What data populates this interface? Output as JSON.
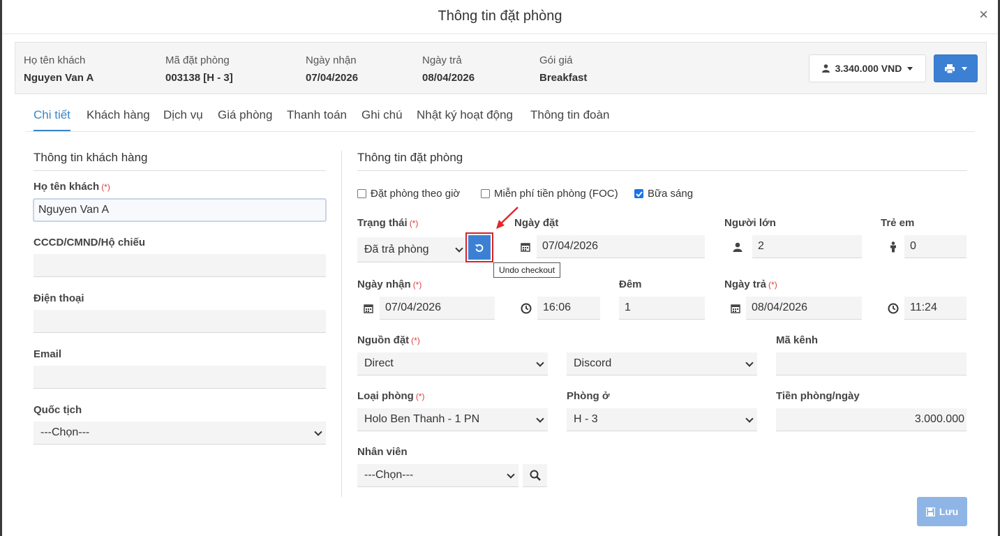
{
  "modal": {
    "title": "Thông tin đặt phòng",
    "close": "×"
  },
  "summary": {
    "guest_label": "Họ tên khách",
    "guest_value": "Nguyen Van A",
    "code_label": "Mã đặt phòng",
    "code_value": "003138 [H - 3]",
    "checkin_label": "Ngày nhận",
    "checkin_value": "07/04/2026",
    "checkout_label": "Ngày trả",
    "checkout_value": "08/04/2026",
    "package_label": "Gói giá",
    "package_value": "Breakfast",
    "total": "3.340.000 VND"
  },
  "tabs": [
    "Chi tiết",
    "Khách hàng",
    "Dịch vụ",
    "Giá phòng",
    "Thanh toán",
    "Ghi chú",
    "Nhật ký hoạt động",
    "Thông tin đoàn"
  ],
  "left": {
    "title": "Thông tin khách hàng",
    "name_label": "Họ tên khách",
    "name_value": "Nguyen Van A",
    "id_label": "CCCD/CMND/Hộ chiếu",
    "id_value": "",
    "phone_label": "Điện thoại",
    "phone_value": "",
    "email_label": "Email",
    "email_value": "",
    "nationality_label": "Quốc tịch",
    "nationality_value": "---Chọn---"
  },
  "right": {
    "title": "Thông tin đặt phòng",
    "check_hourly": "Đặt phòng theo giờ",
    "check_foc": "Miễn phí tiền phòng (FOC)",
    "check_breakfast": "Bữa sáng",
    "status_label": "Trạng thái",
    "status_value": "Đã trả phòng",
    "booking_date_label": "Ngày đặt",
    "booking_date_value": "07/04/2026",
    "adults_label": "Người lớn",
    "adults_value": "2",
    "children_label": "Trẻ em",
    "children_value": "0",
    "checkin_label": "Ngày nhận",
    "checkin_date": "07/04/2026",
    "checkin_time": "16:06",
    "nights_label": "Đêm",
    "nights_value": "1",
    "checkout_label": "Ngày trả",
    "checkout_date": "08/04/2026",
    "checkout_time": "11:24",
    "source_label": "Nguồn đặt",
    "source_value": "Direct",
    "source_sub_value": "Discord",
    "channel_label": "Mã kênh",
    "channel_value": "",
    "room_type_label": "Loại phòng",
    "room_type_value": "Holo Ben Thanh - 1 PN",
    "room_label": "Phòng ở",
    "room_value": "H - 3",
    "rate_label": "Tiền phòng/ngày",
    "rate_value": "3.000.000",
    "staff_label": "Nhân viên",
    "staff_value": "---Chọn---"
  },
  "required_mark": "(*)",
  "tooltip": "Undo checkout",
  "save_label": "Lưu",
  "colors": {
    "primary": "#3c80d4",
    "active_tab": "#3a86c8",
    "highlight": "#d4232b",
    "required": "#e03c3c"
  }
}
